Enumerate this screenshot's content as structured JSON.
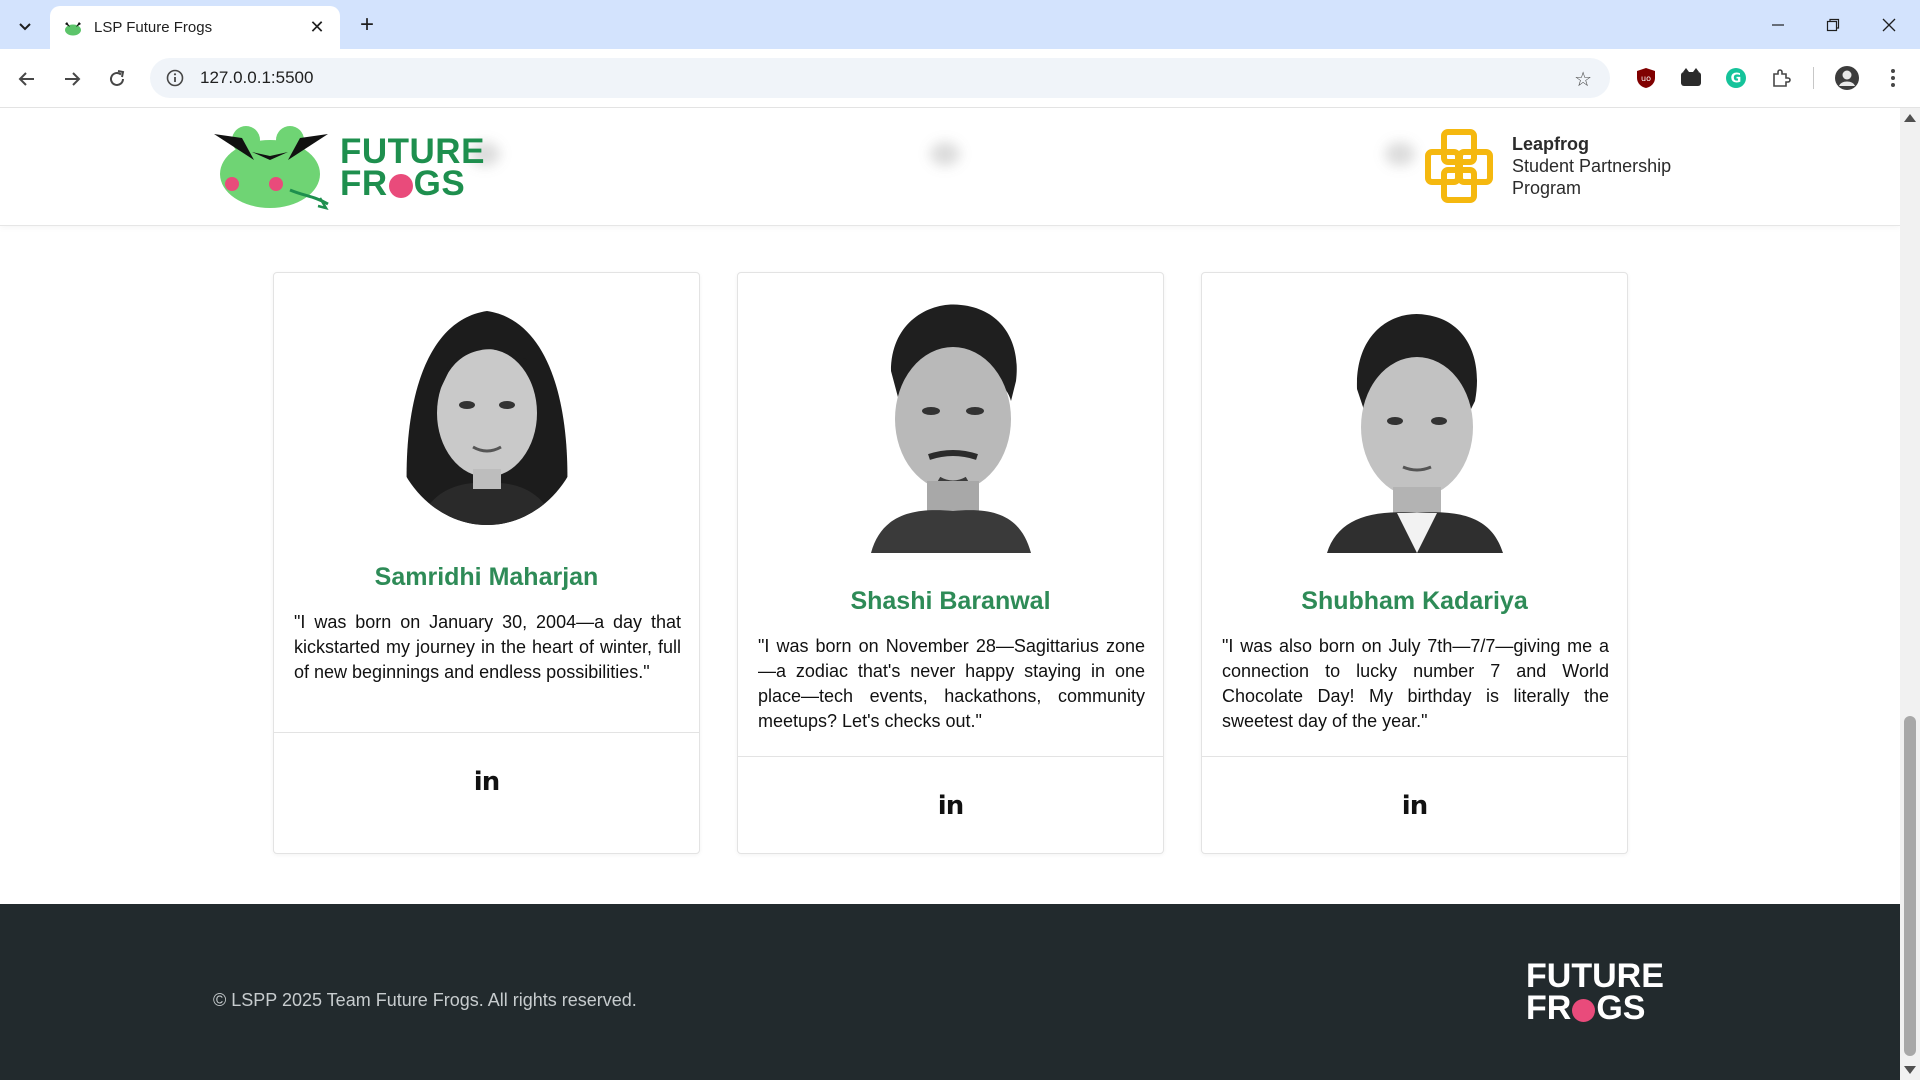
{
  "browser": {
    "tab_title": "LSP Future Frogs",
    "url": "127.0.0.1:5500",
    "icons": [
      "tab-list-icon",
      "frog-favicon-icon",
      "close-icon",
      "plus-icon",
      "minimize-icon",
      "restore-icon",
      "window-close-icon",
      "back-icon",
      "forward-icon",
      "reload-icon",
      "site-info-icon",
      "star-icon",
      "ublock-icon",
      "extension-cat-icon",
      "grammarly-icon",
      "puzzle-icon",
      "profile-avatar-icon",
      "more-vert-icon"
    ]
  },
  "header": {
    "logo_left": {
      "line1": "FUTURE",
      "line2_pre": "FR",
      "line2_post": "GS"
    },
    "logo_right": {
      "line1": "Leapfrog",
      "line2": "Student Partnership",
      "line3": "Program"
    }
  },
  "members": [
    {
      "name": "Samridhi Maharjan",
      "quote": "\"I was born on January 30, 2004—a day that kickstarted my journey in the heart of winter, full of new beginnings and endless possibilities.\"",
      "social": "in"
    },
    {
      "name": "Shashi Baranwal",
      "quote": "\"I was born on November 28—Sagittarius zone—a zodiac that's never happy staying in one place—tech events, hackathons, community meetups? Let's checks out.\"",
      "social": "in"
    },
    {
      "name": "Shubham Kadariya",
      "quote": "\"I was also born on July 7th—7/7—giving me a connection to lucky number 7 and World Chocolate Day! My birthday is literally the sweetest day of the year.\"",
      "social": "in"
    }
  ],
  "footer": {
    "copyright": "© LSPP 2025 Team Future Frogs. All rights reserved.",
    "logo": {
      "line1": "FUTURE",
      "line2_pre": "FR",
      "line2_post": "GS"
    }
  },
  "colors": {
    "accent_green": "#2e8b57",
    "logo_pink": "#e94b7b",
    "footer_bg": "#222a2d",
    "leapfrog_yellow": "#f5b80f"
  }
}
